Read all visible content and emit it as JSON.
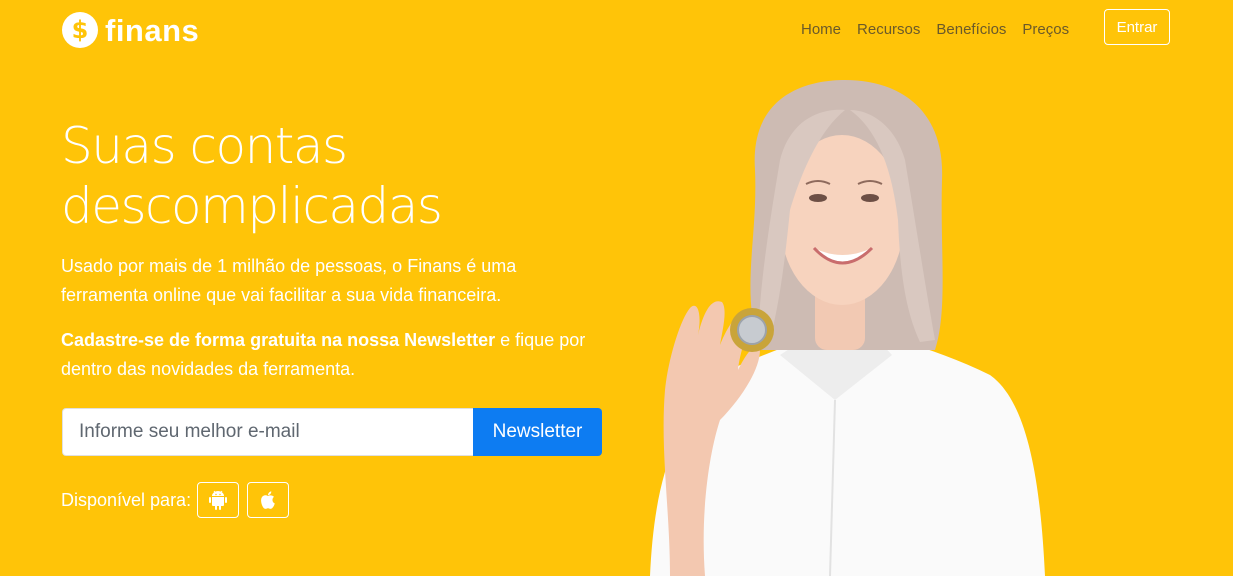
{
  "navbar": {
    "brand_icon_glyph": "$",
    "brand_name": "finans",
    "links": [
      "Home",
      "Recursos",
      "Benefícios",
      "Preços"
    ],
    "login_label": "Entrar"
  },
  "hero": {
    "title_line1": "Suas contas",
    "title_line2": "descomplicadas",
    "subtitle": "Usado por mais de 1 milhão de pessoas, o Finans é uma ferramenta online que vai facilitar a sua vida financeira.",
    "newsletter_bold": "Cadastre-se de forma gratuita na nossa Newsletter",
    "newsletter_rest": " e fique por dentro das novidades da ferramenta.",
    "email_placeholder": "Informe seu melhor e-mail",
    "newsletter_button": "Newsletter",
    "available_label": "Disponível para:",
    "platforms": [
      "android-icon",
      "apple-icon"
    ]
  },
  "colors": {
    "background": "#FFC408",
    "button_blue": "#0d7cf2",
    "nav_link": "#6b5a2a"
  }
}
